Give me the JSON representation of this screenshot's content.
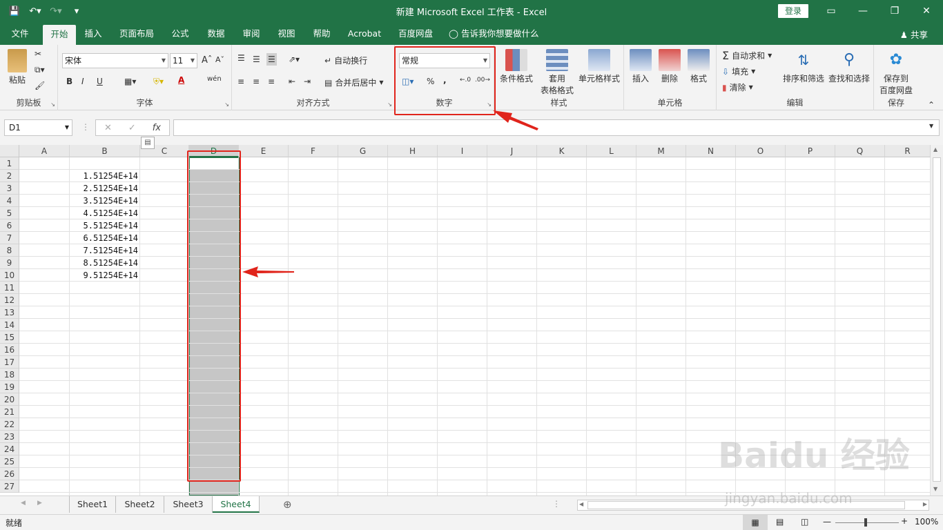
{
  "window": {
    "title": "新建 Microsoft Excel 工作表 - Excel",
    "login_label": "登录"
  },
  "tabs": [
    "文件",
    "开始",
    "插入",
    "页面布局",
    "公式",
    "数据",
    "审阅",
    "视图",
    "帮助",
    "Acrobat",
    "百度网盘"
  ],
  "active_tab": "开始",
  "tell_me": "告诉我你想要做什么",
  "share_label": "共享",
  "ribbon": {
    "clipboard": {
      "label": "剪贴板",
      "paste": "粘贴"
    },
    "font": {
      "label": "字体",
      "font_name": "宋体",
      "font_size": "11",
      "bold": "B",
      "italic": "I",
      "underline": "U",
      "phonetic": "wén"
    },
    "alignment": {
      "label": "对齐方式",
      "wrap_text": "自动换行",
      "merge_center": "合并后居中"
    },
    "number": {
      "label": "数字",
      "format": "常规",
      "percent": "%",
      "comma": ","
    },
    "styles": {
      "label": "样式",
      "conditional": "条件格式",
      "table_line1": "套用",
      "table_line2": "表格格式",
      "cell_styles": "单元格样式"
    },
    "cells": {
      "label": "单元格",
      "insert": "插入",
      "delete": "删除",
      "format": "格式"
    },
    "editing": {
      "label": "编辑",
      "autosum": "自动求和",
      "fill": "填充",
      "clear": "清除",
      "sort_filter": "排序和筛选",
      "find_select": "查找和选择"
    },
    "save": {
      "label": "保存",
      "save_line1": "保存到",
      "save_line2": "百度网盘"
    }
  },
  "formula_bar": {
    "name_box": "D1",
    "fx": "fx",
    "formula": ""
  },
  "columns": [
    "A",
    "B",
    "C",
    "D",
    "E",
    "F",
    "G",
    "H",
    "I",
    "J",
    "K",
    "L",
    "M",
    "N",
    "O",
    "P",
    "Q",
    "R"
  ],
  "rows": [
    "1",
    "2",
    "3",
    "4",
    "5",
    "6",
    "7",
    "8",
    "9",
    "10",
    "11",
    "12",
    "13",
    "14",
    "15",
    "16",
    "17",
    "18",
    "19",
    "20",
    "21",
    "22",
    "23",
    "24",
    "25",
    "26",
    "27"
  ],
  "cells_b": [
    "1.51254E+14",
    "2.51254E+14",
    "3.51254E+14",
    "4.51254E+14",
    "5.51254E+14",
    "6.51254E+14",
    "7.51254E+14",
    "8.51254E+14",
    "9.51254E+14"
  ],
  "sheets": [
    "Sheet1",
    "Sheet2",
    "Sheet3",
    "Sheet4"
  ],
  "active_sheet": "Sheet4",
  "status": {
    "ready": "就绪",
    "zoom": "100%"
  },
  "watermark": {
    "main": "Baidu 经验",
    "sub": "jingyan.baidu.com"
  },
  "colors": {
    "accent": "#217346",
    "annotation": "#e0241b"
  }
}
